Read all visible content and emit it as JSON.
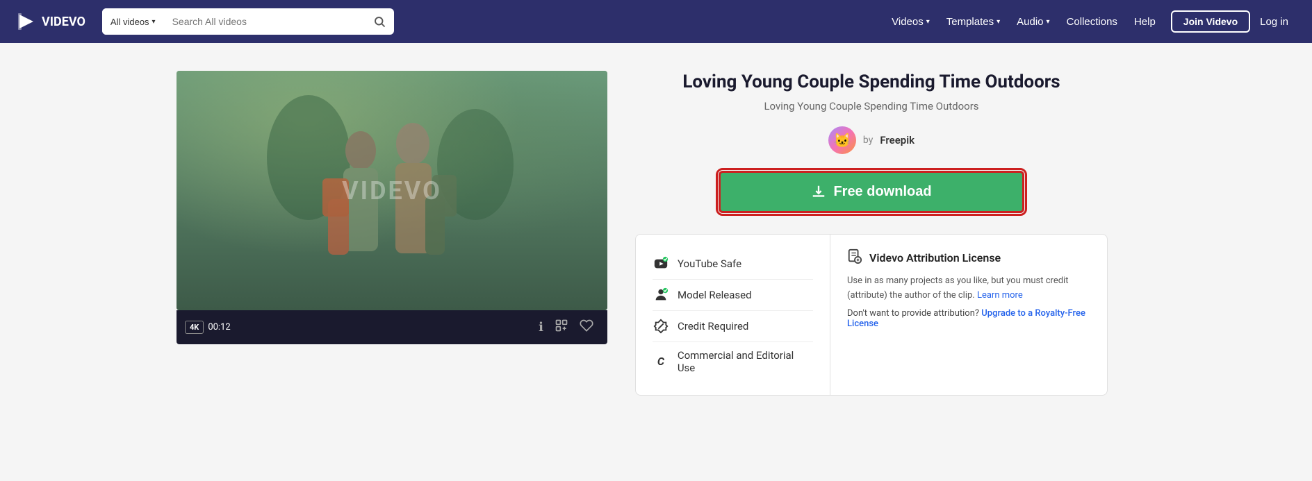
{
  "header": {
    "logo_text": "VIDEVO",
    "search_dropdown_label": "All videos",
    "search_placeholder": "Search All videos",
    "nav_items": [
      {
        "label": "Videos",
        "has_dropdown": true
      },
      {
        "label": "Templates",
        "has_dropdown": true
      },
      {
        "label": "Audio",
        "has_dropdown": true
      },
      {
        "label": "Collections",
        "has_dropdown": false
      },
      {
        "label": "Help",
        "has_dropdown": false
      }
    ],
    "join_btn": "Join Videvo",
    "login_btn": "Log in"
  },
  "video": {
    "title": "Loving Young Couple Spending Time Outdoors",
    "subtitle": "Loving Young Couple Spending Time Outdoors",
    "author_by": "by",
    "author_name": "Freepik",
    "resolution": "4K",
    "duration": "00:12",
    "watermark": "VIDEVO",
    "download_btn": "Free download"
  },
  "attributes": [
    {
      "icon": "🎬",
      "label": "YouTube Safe",
      "name": "youtube-safe"
    },
    {
      "icon": "👤",
      "label": "Model Released",
      "name": "model-released"
    },
    {
      "icon": "✏️",
      "label": "Credit Required",
      "name": "credit-required"
    },
    {
      "icon": "C",
      "label": "Commercial and Editorial Use",
      "name": "commercial-editorial"
    }
  ],
  "license": {
    "title": "Videvo Attribution License",
    "icon": "📋",
    "description": "Use in as many projects as you like, but you must credit (attribute) the author of the clip.",
    "learn_more": "Learn more",
    "attribution_prompt": "Don't want to provide attribution?",
    "upgrade_link": "Upgrade to a Royalty-Free License"
  }
}
